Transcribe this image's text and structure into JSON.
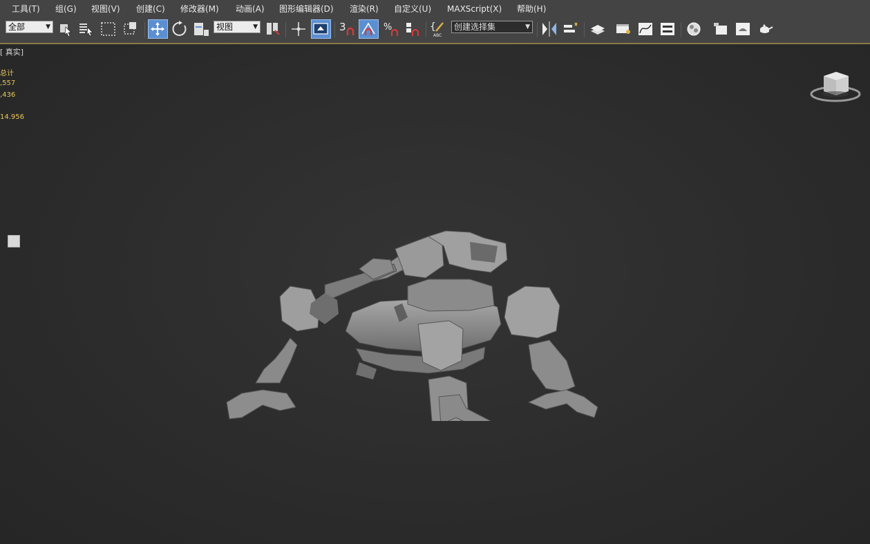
{
  "menu": [
    {
      "id": "tools",
      "label": "工具(T)"
    },
    {
      "id": "group",
      "label": "组(G)"
    },
    {
      "id": "views",
      "label": "视图(V)"
    },
    {
      "id": "create",
      "label": "创建(C)"
    },
    {
      "id": "modifiers",
      "label": "修改器(M)"
    },
    {
      "id": "animation",
      "label": "动画(A)"
    },
    {
      "id": "graph-editors",
      "label": "图形编辑器(D)"
    },
    {
      "id": "rendering",
      "label": "渲染(R)"
    },
    {
      "id": "customize",
      "label": "自定义(U)"
    },
    {
      "id": "maxscript",
      "label": "MAXScript(X)"
    },
    {
      "id": "help",
      "label": "帮助(H)"
    }
  ],
  "toolbar": {
    "selection_filter": "全部",
    "reference_coord": "视图",
    "spinner_snap_value": "3",
    "named_selection_set": "创建选择集",
    "accent_color": "#5b8fd1"
  },
  "viewport": {
    "label": "[ 真实]",
    "stats": {
      "header": "总计",
      "polys": ",557",
      "verts": ",436",
      "fps": "14.956"
    },
    "background_color": "#2b2b2b",
    "model_color": "#8e8e8e"
  }
}
